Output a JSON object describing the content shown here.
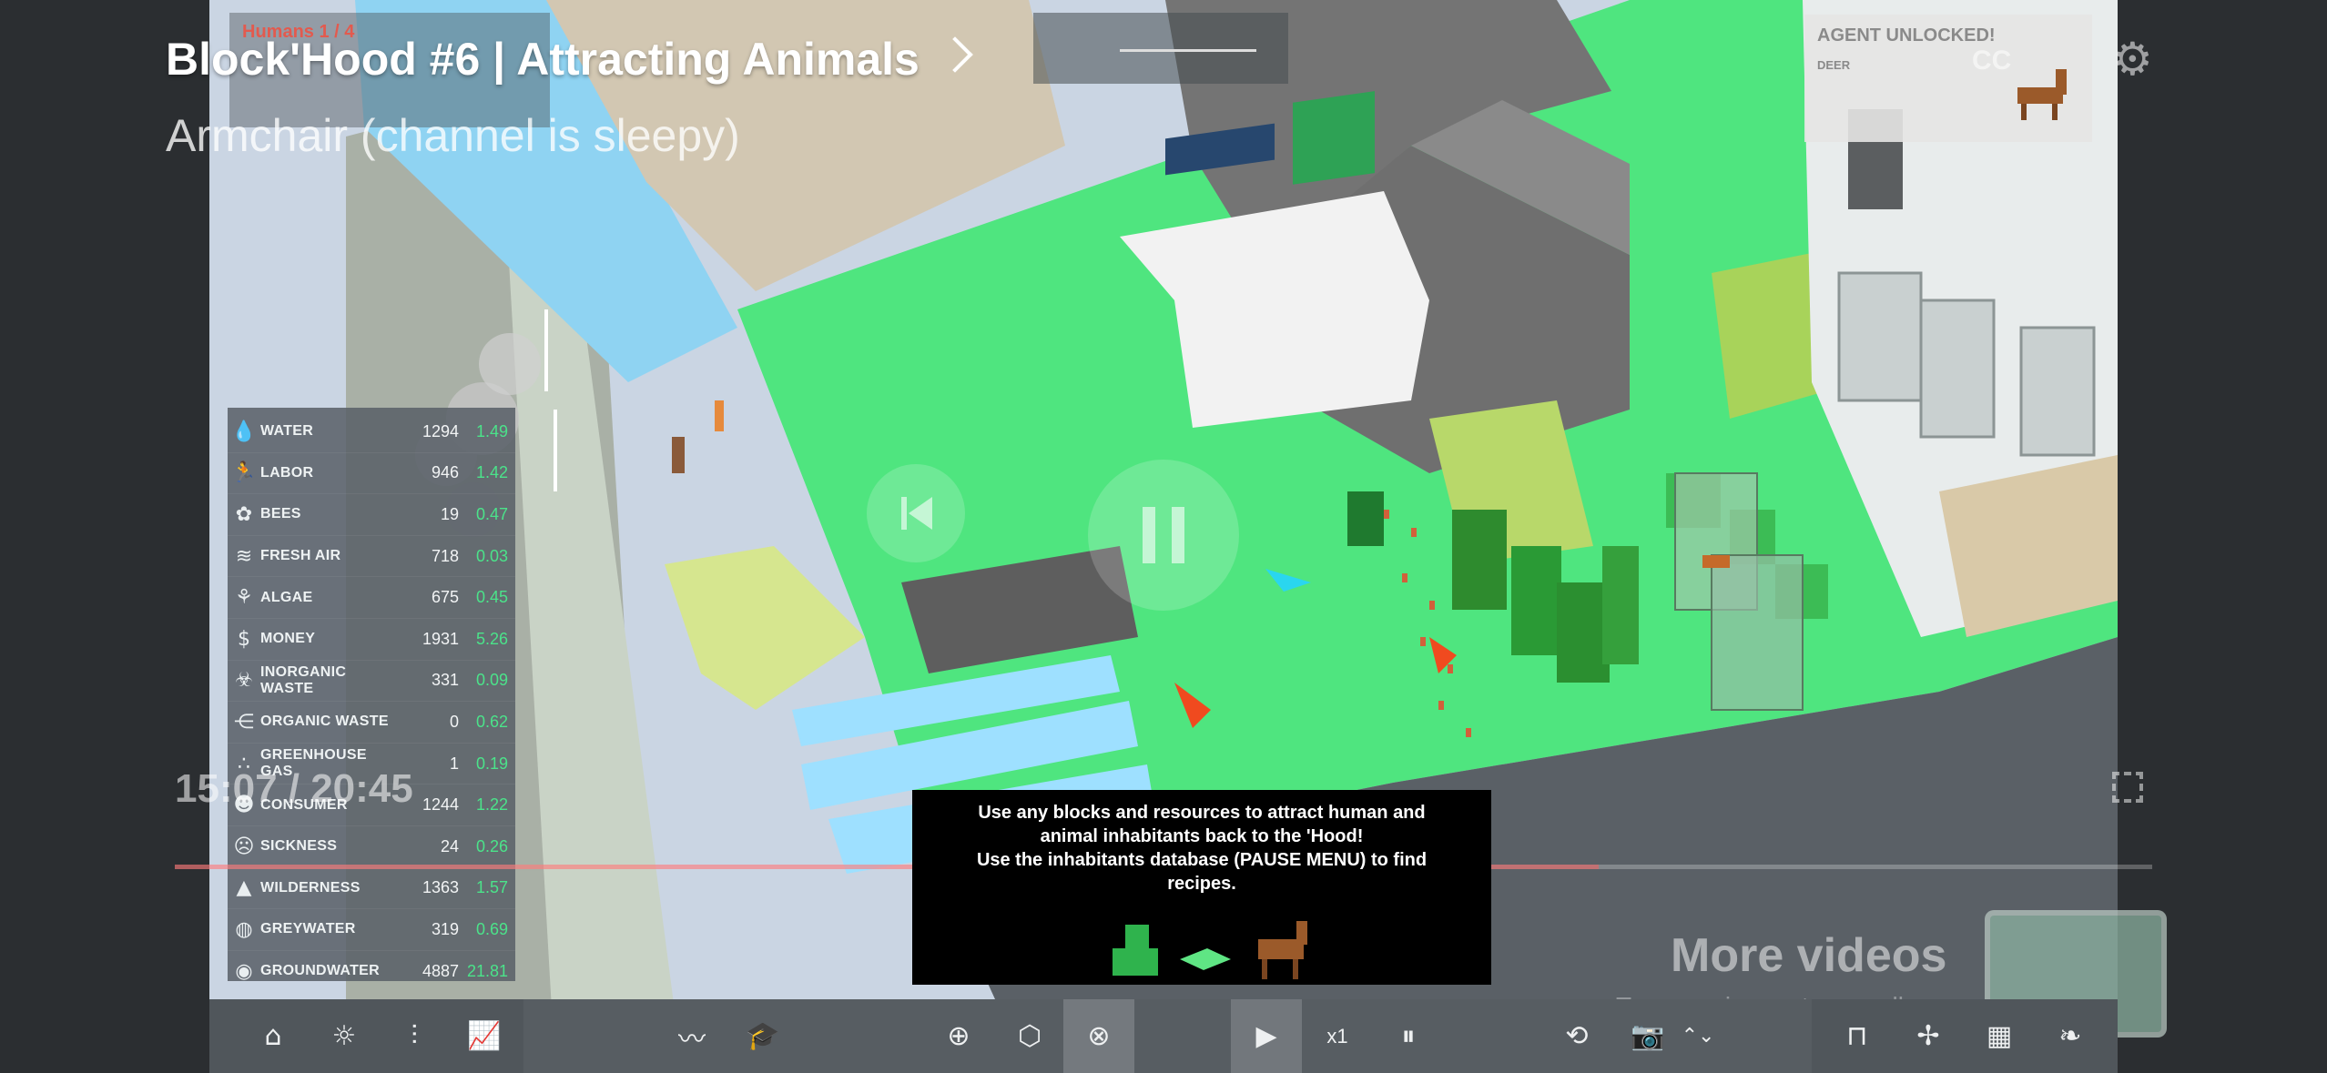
{
  "video": {
    "title": "Block'Hood #6 | Attracting Animals",
    "channel": "Armchair (channel is sleepy)",
    "time": "15:07 / 20:45",
    "more_videos": "More videos",
    "swipe_hint": "Tap or swipe up to see all"
  },
  "hud": {
    "humans_label": "Humans 1 / 4",
    "agent_title": "AGENT UNLOCKED!",
    "agent_name": "DEER"
  },
  "resources": [
    {
      "name": "WATER",
      "icon": "water-drop-icon",
      "glyph": "💧",
      "value": "1294",
      "rate": "1.49"
    },
    {
      "name": "LABOR",
      "icon": "runner-icon",
      "glyph": "🏃",
      "value": "946",
      "rate": "1.42"
    },
    {
      "name": "BEES",
      "icon": "bee-icon",
      "glyph": "✿",
      "value": "19",
      "rate": "0.47"
    },
    {
      "name": "FRESH AIR",
      "icon": "wind-icon",
      "glyph": "≋",
      "value": "718",
      "rate": "0.03"
    },
    {
      "name": "ALGAE",
      "icon": "sprout-icon",
      "glyph": "⚘",
      "value": "675",
      "rate": "0.45"
    },
    {
      "name": "MONEY",
      "icon": "dollar-icon",
      "glyph": "$",
      "value": "1931",
      "rate": "5.26"
    },
    {
      "name": "INORGANIC WASTE",
      "icon": "biohazard-icon",
      "glyph": "☣",
      "value": "331",
      "rate": "0.09"
    },
    {
      "name": "ORGANIC WASTE",
      "icon": "fish-bone-icon",
      "glyph": "⋲",
      "value": "0",
      "rate": "0.62"
    },
    {
      "name": "GREENHOUSE GAS",
      "icon": "dots-icon",
      "glyph": "∴",
      "value": "1",
      "rate": "0.19"
    },
    {
      "name": "CONSUMER",
      "icon": "person-group-icon",
      "glyph": "☻",
      "value": "1244",
      "rate": "1.22"
    },
    {
      "name": "SICKNESS",
      "icon": "sick-face-icon",
      "glyph": "☹",
      "value": "24",
      "rate": "0.26"
    },
    {
      "name": "WILDERNESS",
      "icon": "mountain-icon",
      "glyph": "▲",
      "value": "1363",
      "rate": "1.57"
    },
    {
      "name": "GREYWATER",
      "icon": "grey-drop-icon",
      "glyph": "◍",
      "value": "319",
      "rate": "0.69"
    },
    {
      "name": "GROUNDWATER",
      "icon": "ground-drop-icon",
      "glyph": "◉",
      "value": "4887",
      "rate": "21.81"
    }
  ],
  "tutorial": {
    "line1": "Use any blocks and resources to attract human and",
    "line2": "animal inhabitants back to the 'Hood!",
    "line3": "Use the inhabitants database (PAUSE MENU) to find",
    "line4": "recipes."
  },
  "toolbar": {
    "speed": "x1"
  },
  "colors": {
    "grass": "#4fe57f",
    "concrete": "#737373",
    "water": "#8fd6f5",
    "rate_green": "#4be38a",
    "toolbar": "#575d62"
  }
}
